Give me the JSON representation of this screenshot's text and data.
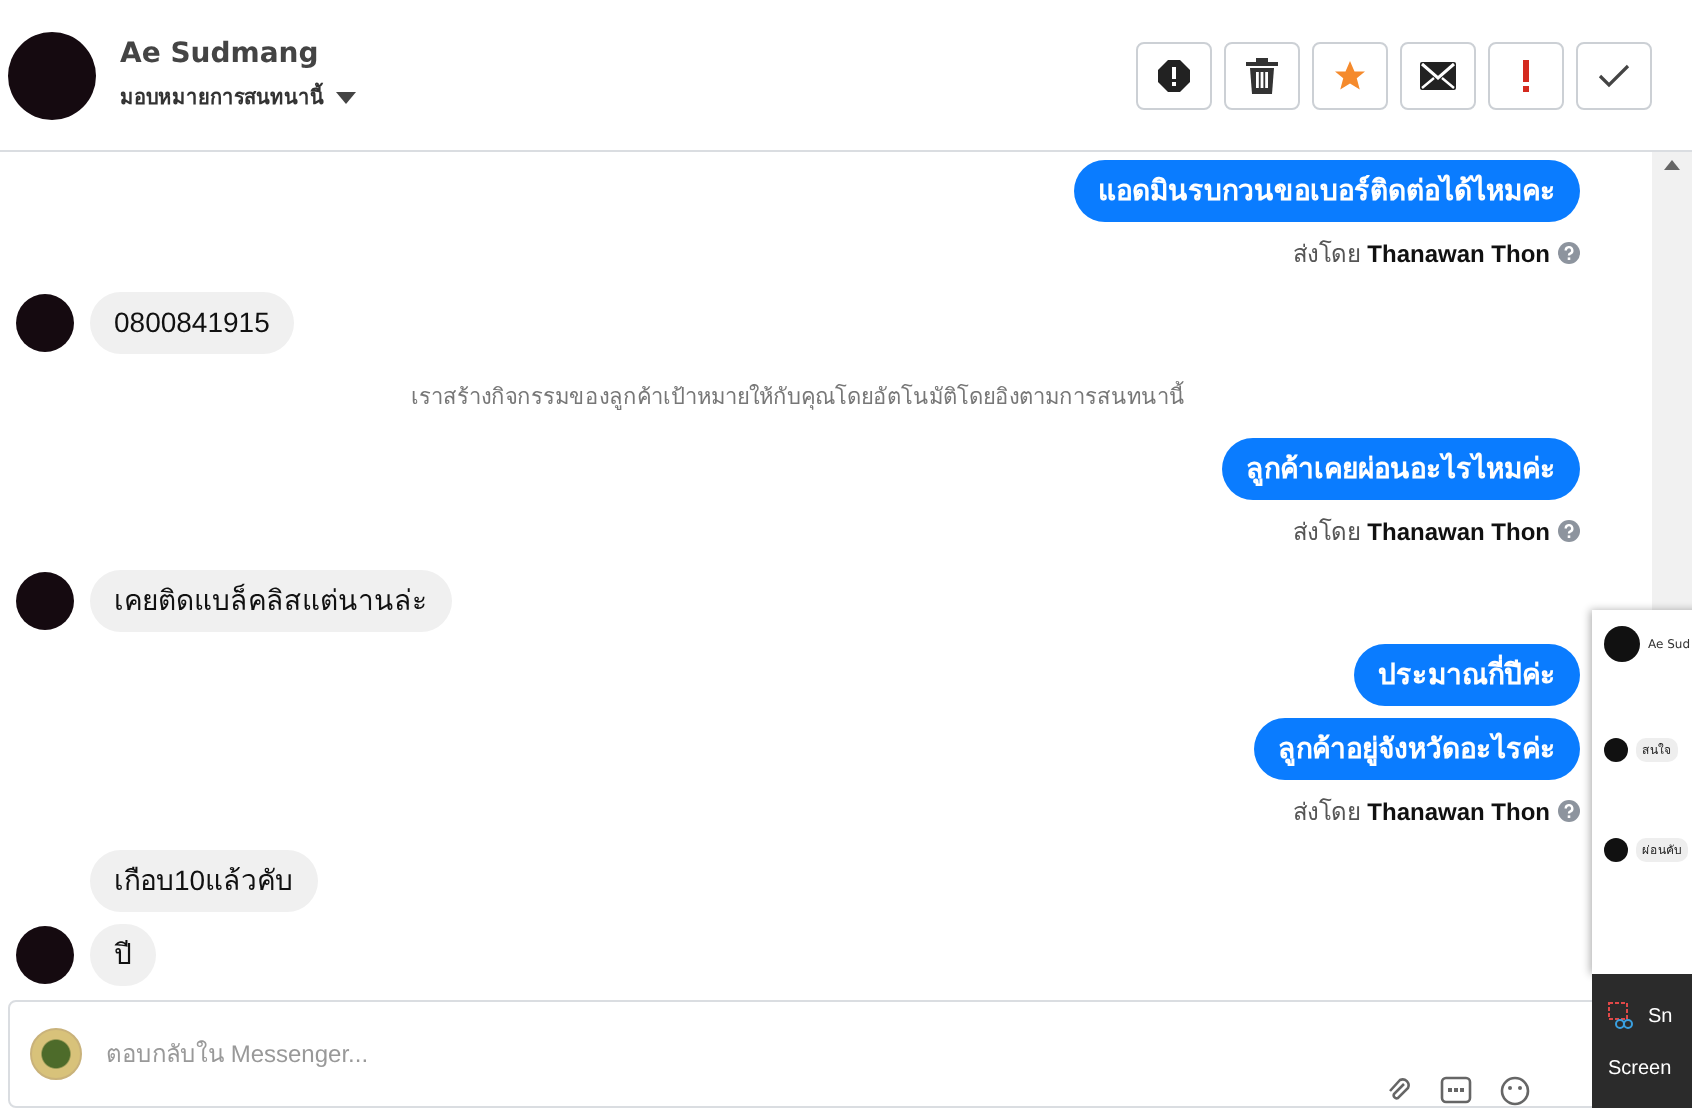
{
  "header": {
    "name": "Ae Sudmang",
    "assign_label": "มอบหมายการสนทนานี้"
  },
  "toolbar": [
    {
      "kind": "report"
    },
    {
      "kind": "trash"
    },
    {
      "kind": "star"
    },
    {
      "kind": "mail"
    },
    {
      "kind": "alert"
    },
    {
      "kind": "check"
    }
  ],
  "messages": [
    {
      "kind": "outgoing",
      "text": "แอดมินรบกวนขอเบอร์ติดต่อได้ไหมคะ"
    },
    {
      "kind": "sender",
      "prefix": "ส่งโดย",
      "name": "Thanawan Thon"
    },
    {
      "kind": "incoming",
      "text": "0800841915",
      "avatar": true
    },
    {
      "kind": "system",
      "text": "เราสร้างกิจกรรมของลูกค้าเป้าหมายให้กับคุณโดยอัตโนมัติโดยอิงตามการสนทนานี้"
    },
    {
      "kind": "outgoing",
      "text": "ลูกค้าเคยผ่อนอะไรไหมค่ะ"
    },
    {
      "kind": "sender",
      "prefix": "ส่งโดย",
      "name": "Thanawan Thon"
    },
    {
      "kind": "incoming",
      "text": "เคยติดแบล็คลิสแต่นานล่ะ",
      "avatar": true
    },
    {
      "kind": "outgoing",
      "text": "ประมาณกี่ปีค่ะ"
    },
    {
      "kind": "outgoing",
      "text": "ลูกค้าอยู่จังหวัดอะไรค่ะ"
    },
    {
      "kind": "sender",
      "prefix": "ส่งโดย",
      "name": "Thanawan Thon"
    },
    {
      "kind": "incoming",
      "text": "เกือบ10แล้วคับ",
      "avatar": false
    },
    {
      "kind": "incoming",
      "text": "ปี",
      "avatar": true
    }
  ],
  "composer": {
    "placeholder": "ตอบกลับใน Messenger..."
  },
  "preview": {
    "title": "Ae Sud",
    "messages": [
      "สนใจ",
      "ผ่อนคับ"
    ]
  },
  "taskbar_menu": {
    "items": [
      "Sn",
      "Screen"
    ]
  }
}
